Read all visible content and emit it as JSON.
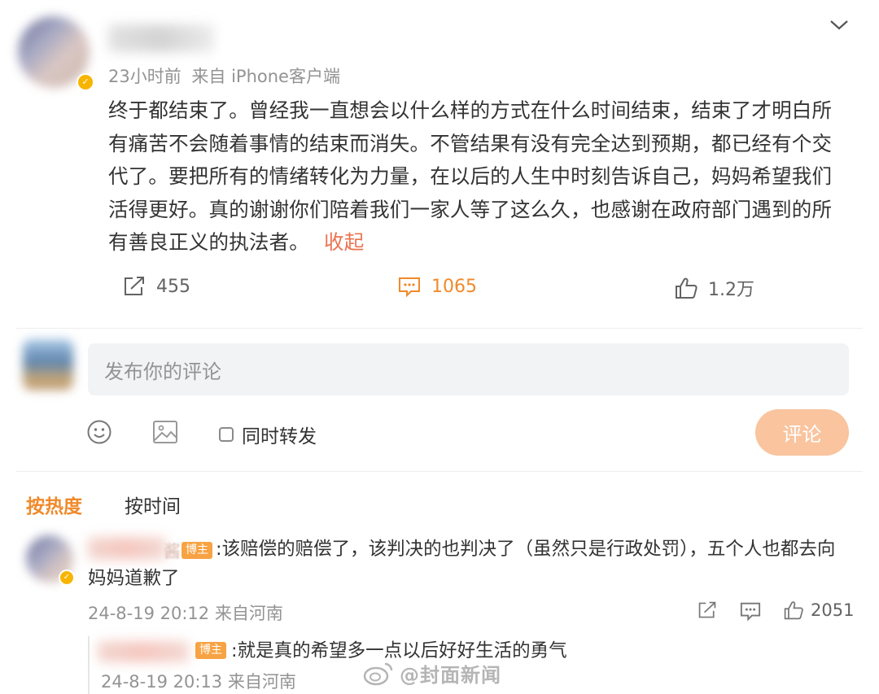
{
  "post": {
    "meta_time": "23小时前",
    "meta_source": "来自 iPhone客户端",
    "body_lines": [
      "终于都结束了。曾经我一直想会以什么样的方式在什么时间结束，结束了才明白所",
      "有痛苦不会随着事情的结束而消失。不管结果有没有完全达到预期，都已经有个交",
      "代了。要把所有的情绪转化为力量，在以后的人生中时刻告诉自己，妈妈希望我们",
      "活得更好。真的谢谢你们陪着我们一家人等了这么久，也感谢在政府部门遇到的所"
    ],
    "body_last_line": "有善良正义的执法者。",
    "collapse_label": "收起",
    "repost_count": "455",
    "comment_count": "1065",
    "like_count": "1.2万"
  },
  "composer": {
    "placeholder": "发布你的评论",
    "repost_label": "同时转发",
    "submit_label": "评论"
  },
  "sort_tabs": [
    "按热度",
    "按时间"
  ],
  "comments": [
    {
      "name_tail": "酱",
      "badge": "博主",
      "text_line1": ":该赔偿的赔偿了，该判决的也判决了（虽然只是行政处罚），五个人也都去向",
      "text_line2": "妈妈道歉了",
      "time": "24-8-19 20:12 来自河南",
      "like_count": "2051"
    }
  ],
  "reply": {
    "badge": "博主",
    "text": ":就是真的希望多一点以后好好生活的勇气",
    "time": "24-8-19 20:13 来自河南"
  },
  "watermark": "@封面新闻",
  "colors": {
    "accent": "#eb7350",
    "comment_active": "#f08a2b",
    "submit_bg": "#f9c49e",
    "badge": "#f7a344",
    "verify": "#f7b500"
  }
}
